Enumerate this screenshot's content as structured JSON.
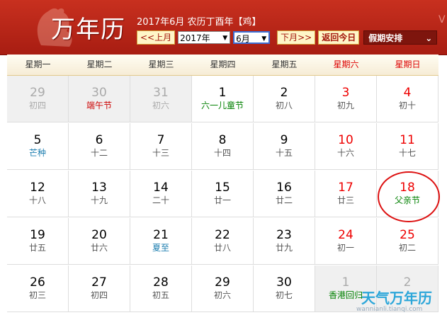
{
  "header": {
    "app_title": "万年历",
    "info": "2017年6月 农历丁酉年【鸡】",
    "prev_label": "<<上月",
    "year_value": "2017年",
    "month_value": "6月",
    "next_label": "下月>>",
    "today_label": "返回今日",
    "holiday_label": "假期安排"
  },
  "weekdays": [
    "星期一",
    "星期二",
    "星期三",
    "星期四",
    "星期五",
    "星期六",
    "星期日"
  ],
  "weeks": [
    [
      {
        "num": "29",
        "lunar": "初四",
        "other": true
      },
      {
        "num": "30",
        "lunar": "端午节",
        "other": true,
        "style": "fest-red"
      },
      {
        "num": "31",
        "lunar": "初六",
        "other": true
      },
      {
        "num": "1",
        "lunar": "六一儿童节",
        "style": "fest-green"
      },
      {
        "num": "2",
        "lunar": "初八"
      },
      {
        "num": "3",
        "lunar": "初九",
        "weekend": true
      },
      {
        "num": "4",
        "lunar": "初十",
        "weekend": true
      }
    ],
    [
      {
        "num": "5",
        "lunar": "芒种",
        "style": "term"
      },
      {
        "num": "6",
        "lunar": "十二"
      },
      {
        "num": "7",
        "lunar": "十三"
      },
      {
        "num": "8",
        "lunar": "十四"
      },
      {
        "num": "9",
        "lunar": "十五"
      },
      {
        "num": "10",
        "lunar": "十六",
        "weekend": true
      },
      {
        "num": "11",
        "lunar": "十七",
        "weekend": true
      }
    ],
    [
      {
        "num": "12",
        "lunar": "十八"
      },
      {
        "num": "13",
        "lunar": "十九"
      },
      {
        "num": "14",
        "lunar": "二十"
      },
      {
        "num": "15",
        "lunar": "廿一"
      },
      {
        "num": "16",
        "lunar": "廿二"
      },
      {
        "num": "17",
        "lunar": "廿三",
        "weekend": true
      },
      {
        "num": "18",
        "lunar": "父亲节",
        "weekend": true,
        "style": "fest-green"
      }
    ],
    [
      {
        "num": "19",
        "lunar": "廿五"
      },
      {
        "num": "20",
        "lunar": "廿六"
      },
      {
        "num": "21",
        "lunar": "夏至",
        "style": "term"
      },
      {
        "num": "22",
        "lunar": "廿八"
      },
      {
        "num": "23",
        "lunar": "廿九"
      },
      {
        "num": "24",
        "lunar": "初一",
        "weekend": true
      },
      {
        "num": "25",
        "lunar": "初二",
        "weekend": true
      }
    ],
    [
      {
        "num": "26",
        "lunar": "初三"
      },
      {
        "num": "27",
        "lunar": "初四"
      },
      {
        "num": "28",
        "lunar": "初五"
      },
      {
        "num": "29",
        "lunar": "初六"
      },
      {
        "num": "30",
        "lunar": "初七"
      },
      {
        "num": "1",
        "lunar": "香港回归",
        "other": true,
        "style": "fest-green"
      },
      {
        "num": "2",
        "lunar": "",
        "other": true
      }
    ]
  ],
  "watermark": {
    "brand": "天气万年历",
    "url": "wannianli.tianqi.com"
  }
}
